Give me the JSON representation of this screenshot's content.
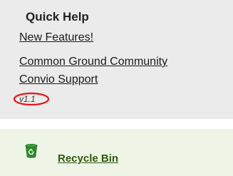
{
  "quick_help": {
    "title": "Quick Help",
    "links": [
      {
        "label": "New Features!"
      },
      {
        "label": "Common Ground Community"
      },
      {
        "label": "Convio Support"
      }
    ],
    "version": "v1.1"
  },
  "recycle_bin": {
    "label": "Recycle Bin",
    "icon": "recycle-bin-icon"
  },
  "colors": {
    "panel_background": "#ebebeb",
    "recycle_panel_background": "#eef4e6",
    "recycle_link": "#2e5a12",
    "version_oval": "#e4161c",
    "recycle_icon": "#2e8b2e"
  }
}
